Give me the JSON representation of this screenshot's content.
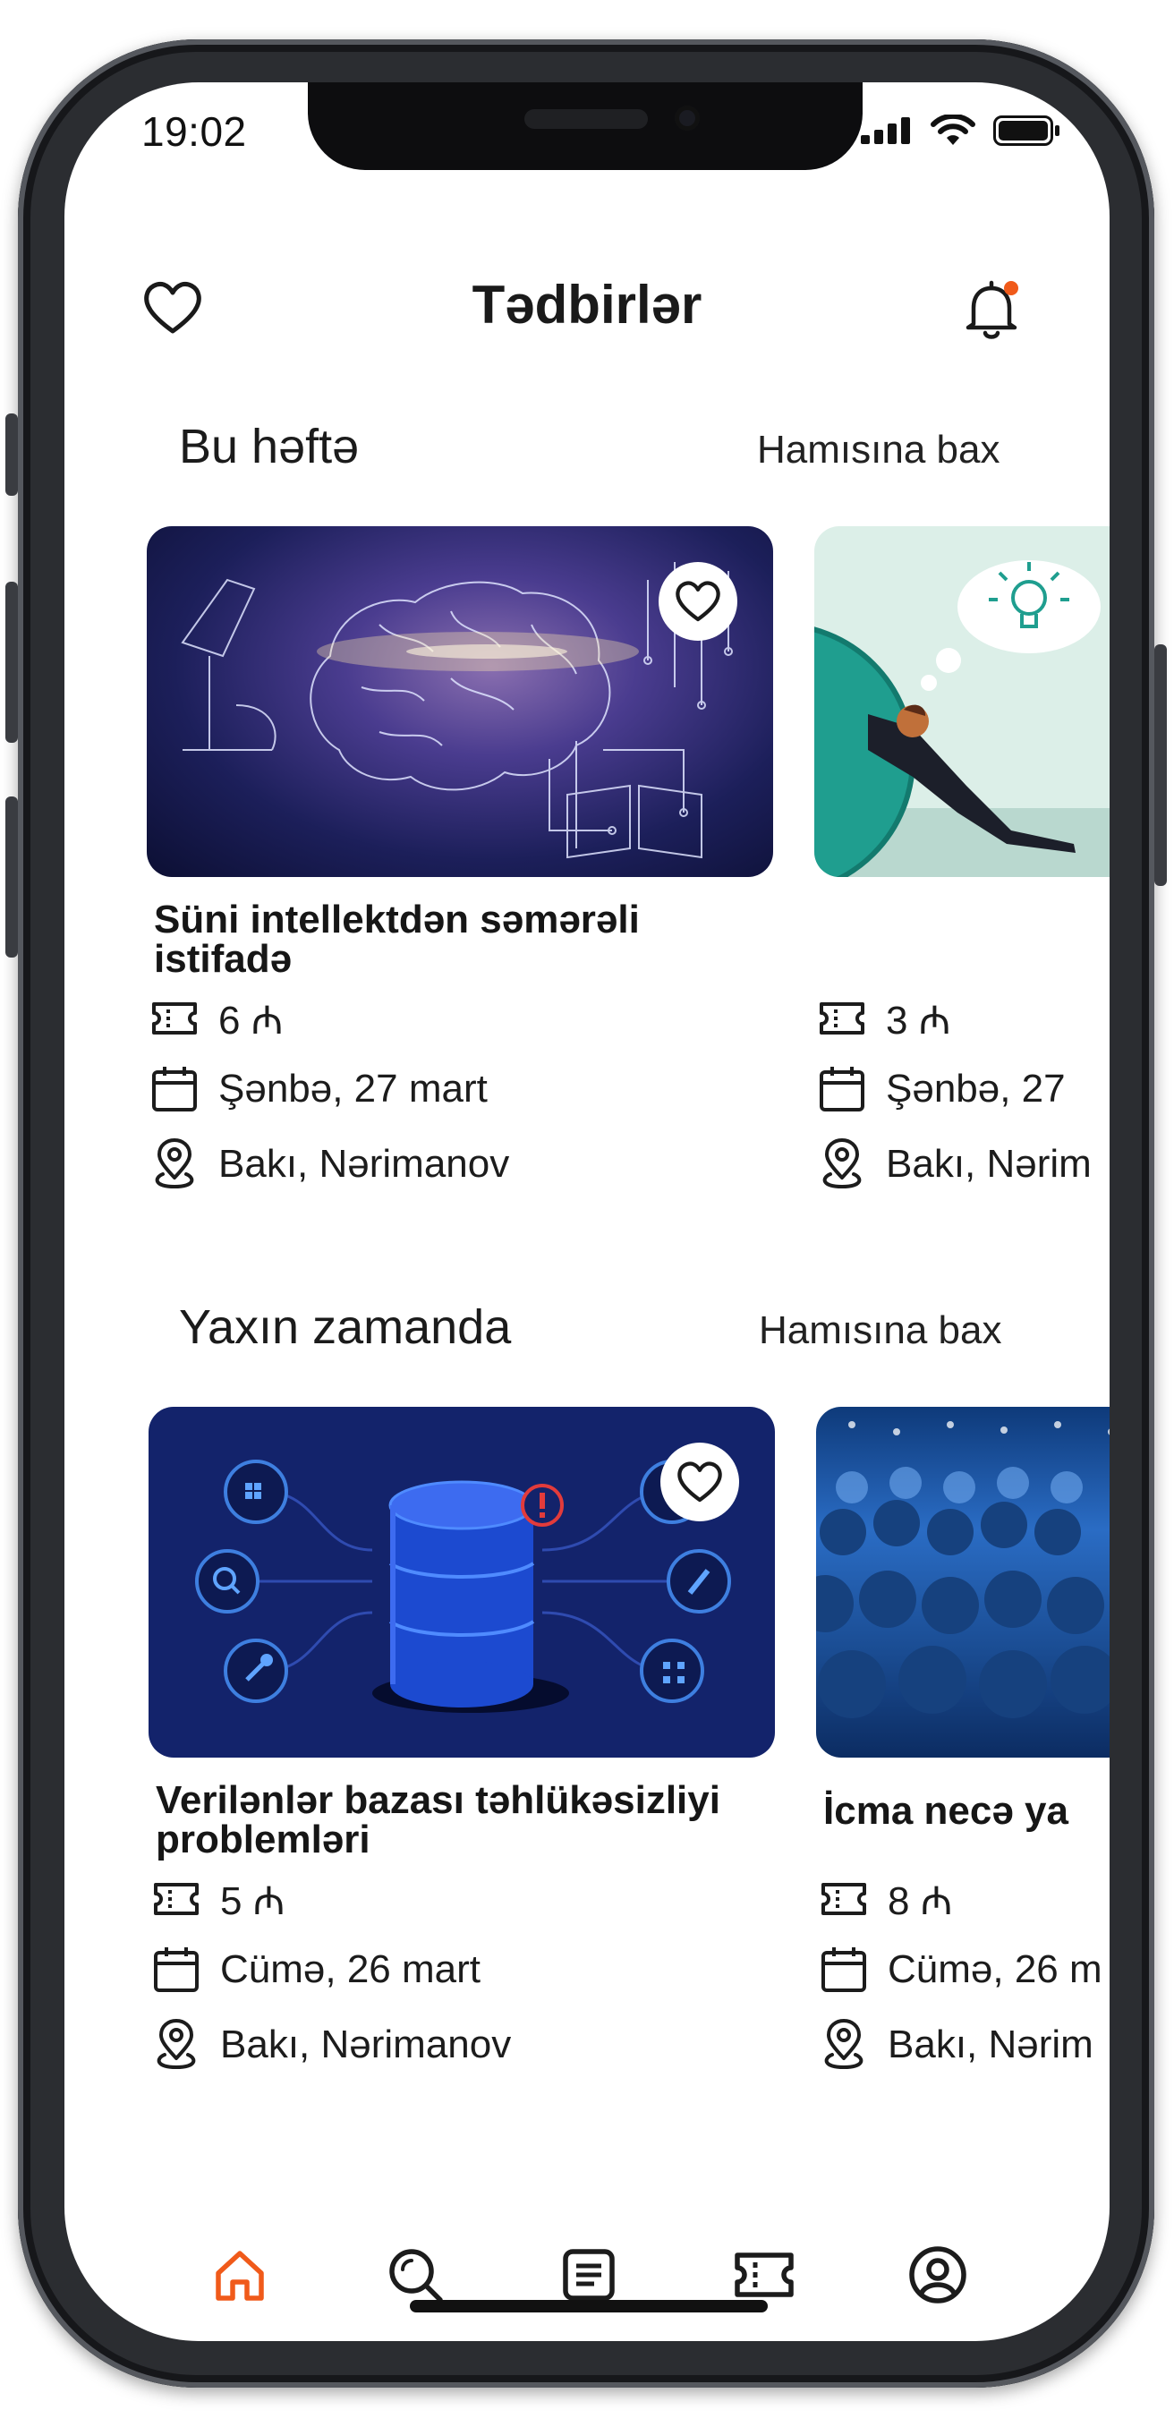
{
  "status_bar": {
    "time": "19:02"
  },
  "header": {
    "title": "Tədbirlər"
  },
  "sections": [
    {
      "title": "Bu həftə",
      "see_all": "Hamısına bax",
      "events": [
        {
          "title": "Süni intellektdən səmərəli istifadə",
          "price": "6 ₼",
          "date": "Şənbə, 27 mart",
          "location": "Bakı, Nərimanov",
          "image": "brain-circuit-illustration"
        },
        {
          "title": "",
          "price": "3 ₼",
          "date": "Şənbə, 27",
          "location": "Bakı, Nərim",
          "image": "man-pushing-sphere-illustration"
        }
      ]
    },
    {
      "title": "Yaxın zamanda",
      "see_all": "Hamısına bax",
      "events": [
        {
          "title": "Verilənlər bazası təhlükəsizliyi problemləri",
          "price": "5 ₼",
          "date": "Cümə, 26 mart",
          "location": "Bakı, Nərimanov",
          "image": "database-security-illustration"
        },
        {
          "title": "İcma necə ya",
          "price": "8 ₼",
          "date": "Cümə, 26 m",
          "location": "Bakı, Nərim",
          "image": "conference-crowd-photo"
        }
      ]
    }
  ],
  "tab_bar": {
    "active": "home",
    "tabs": [
      "home-icon",
      "search-icon",
      "list-icon",
      "ticket-icon",
      "profile-icon"
    ]
  },
  "colors": {
    "accent": "#F05A1A",
    "text": "#1C1C1C",
    "card_dark": "#12236B"
  }
}
